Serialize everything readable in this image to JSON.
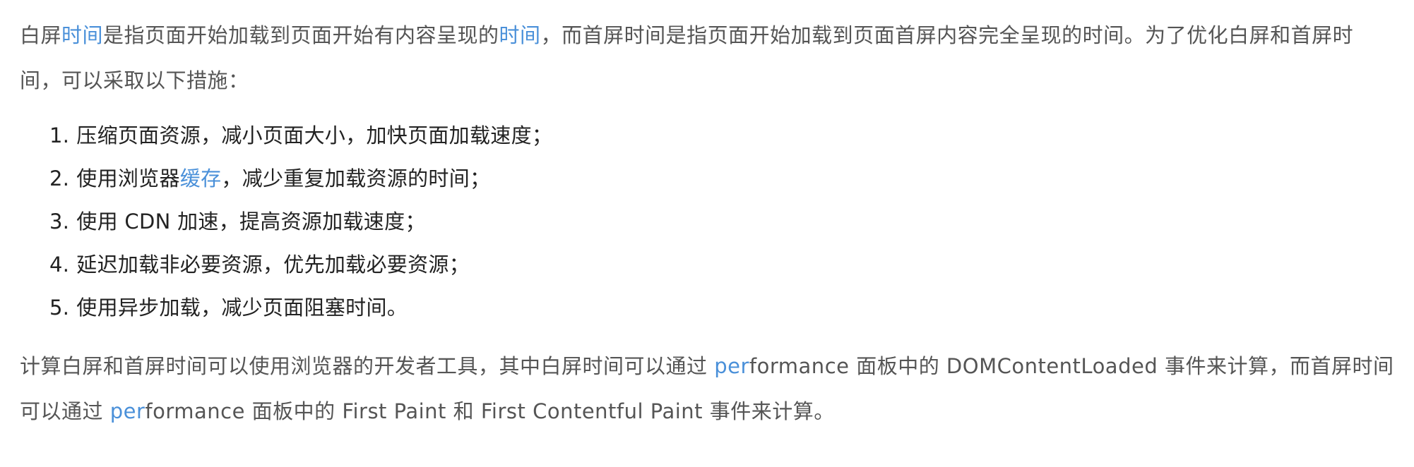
{
  "colors": {
    "text": "#555555",
    "list_text": "#222222",
    "link": "#4a90d9",
    "background": "#ffffff"
  },
  "para1": {
    "p1": "白屏",
    "link1": "时间",
    "p2": "是指页面开始加载到页面开始有内容呈现的",
    "link2": "时间",
    "p3": "，而首屏时间是指页面开始加载到页面首屏内容完全呈现的时间。为了优化白屏和首屏时间，可以采取以下措施："
  },
  "steps": [
    {
      "num": "1.",
      "text": "压缩页面资源，减小页面大小，加快页面加载速度；"
    },
    {
      "num": "2.",
      "before": "使用浏览器",
      "link": "缓存",
      "after": "，减少重复加载资源的时间；"
    },
    {
      "num": "3.",
      "text": "使用 CDN 加速，提高资源加载速度；"
    },
    {
      "num": "4.",
      "text": "延迟加载非必要资源，优先加载必要资源；"
    },
    {
      "num": "5.",
      "text": "使用异步加载，减少页面阻塞时间。"
    }
  ],
  "para2": {
    "p1": "计算白屏和首屏时间可以使用浏览器的开发者工具，其中白屏时间可以通过 ",
    "link1": "per",
    "p2": "formance 面板中的 DOMContentLoaded 事件来计算，而首屏时间可以通过 ",
    "link2": "per",
    "p3": "formance 面板中的 First Paint 和 First Contentful Paint 事件来计算。"
  }
}
